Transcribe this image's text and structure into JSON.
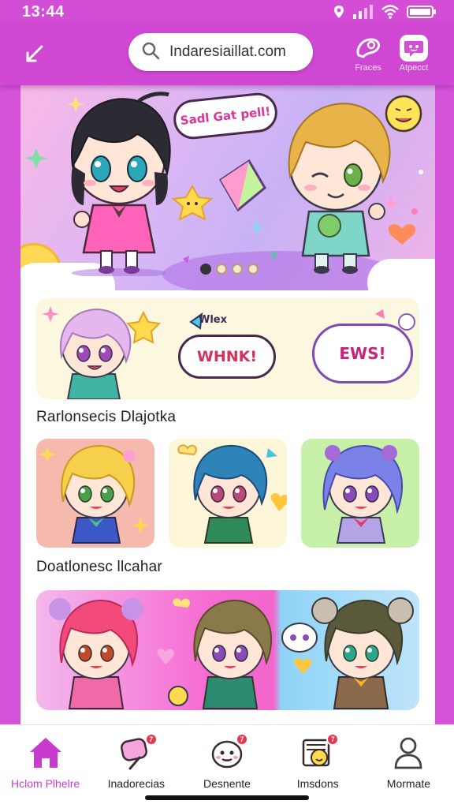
{
  "status_bar": {
    "time": "13:44",
    "icons": [
      "location-icon",
      "signal-icon",
      "wifi-icon",
      "battery-icon"
    ]
  },
  "top_bar": {
    "search_value": "Indaresiaillat.com",
    "actions": [
      {
        "icon": "sticker-icon",
        "label": "Fraces"
      },
      {
        "icon": "chat-icon",
        "label": "Atpecct"
      }
    ]
  },
  "hero": {
    "bubble_text": "Sadl Gat pell!",
    "slide_count": 4,
    "active_slide": 0
  },
  "sticker_card": {
    "small_text": "Wlex",
    "bubble1": "WHNK!",
    "bubble2": "EWS!"
  },
  "sections": [
    {
      "title": "Rarlonsecis Dlajotka"
    },
    {
      "title": "Doatlonesc llcahar"
    }
  ],
  "bottom_nav": [
    {
      "label": "Hclom Plhelre",
      "icon": "home-icon",
      "active": true,
      "badge": ""
    },
    {
      "label": "Inadorecias",
      "icon": "sticker-brush-icon",
      "active": false,
      "badge": "7"
    },
    {
      "label": "Desnente",
      "icon": "emoji-face-icon",
      "active": false,
      "badge": "7"
    },
    {
      "label": "Imsdons",
      "icon": "calendar-emoji-icon",
      "active": false,
      "badge": "7"
    },
    {
      "label": "Mormate",
      "icon": "profile-icon",
      "active": false,
      "badge": ""
    }
  ],
  "colors": {
    "brand": "#d452d8",
    "active_nav": "#c83bcf",
    "badge": "#e8344e"
  }
}
